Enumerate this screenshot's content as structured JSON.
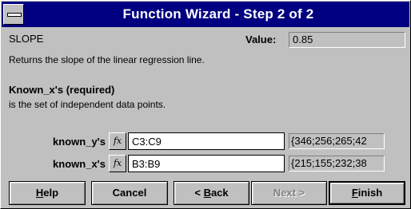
{
  "window": {
    "title": "Function Wizard - Step 2 of 2"
  },
  "function": {
    "name": "SLOPE",
    "value_label": "Value:",
    "value": "0.85",
    "description": "Returns the slope of the linear regression line."
  },
  "argument_help": {
    "title": "Known_x's (required)",
    "description": "is the set of independent data points."
  },
  "arguments": [
    {
      "label": "known_y's",
      "fx": "fx",
      "value": "C3:C9",
      "result": "{346;256;265;42"
    },
    {
      "label": "known_x's",
      "fx": "fx",
      "value": "B3:B9",
      "result": "{215;155;232;38"
    }
  ],
  "buttons": {
    "help": {
      "before": "",
      "key": "H",
      "after": "elp"
    },
    "cancel": {
      "label": "Cancel"
    },
    "back": {
      "prefix": "< ",
      "key": "B",
      "after": "ack"
    },
    "next": {
      "label": "Next >"
    },
    "finish": {
      "before": "",
      "key": "F",
      "after": "inish"
    }
  }
}
